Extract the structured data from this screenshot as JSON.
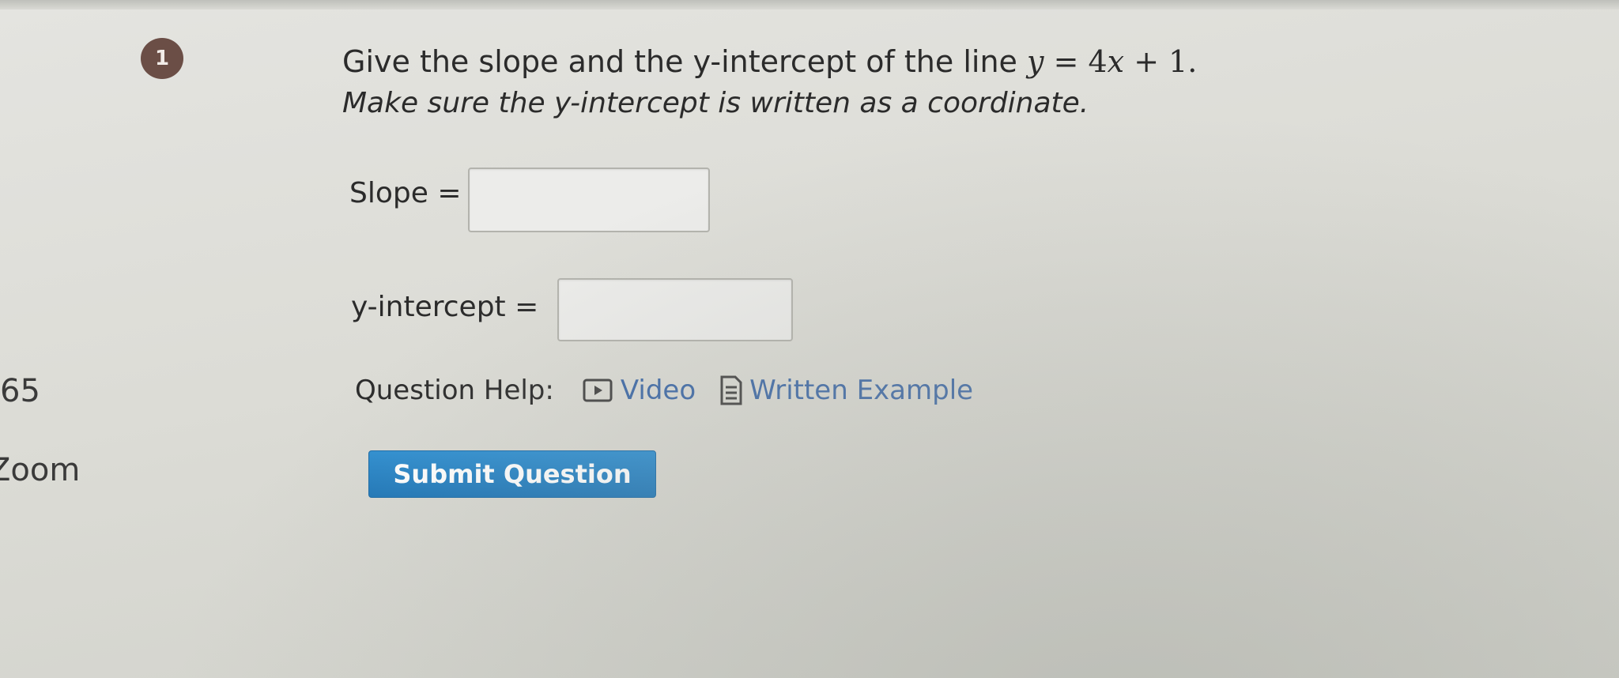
{
  "question": {
    "number": "1",
    "prompt_text": "Give the slope and the y-intercept of the line ",
    "equation": {
      "lhs": "y",
      "eq": " = ",
      "coef": "4",
      "var": "x",
      "plus": " + ",
      "const": "1",
      "end": "."
    },
    "instruction": "Make sure the y-intercept is written as a coordinate."
  },
  "fields": {
    "slope": {
      "label": "Slope =",
      "value": "",
      "placeholder": ""
    },
    "y_intercept": {
      "label": "y-intercept =",
      "value": "",
      "placeholder": ""
    }
  },
  "help": {
    "label": "Question Help:",
    "links": [
      {
        "label": "Video",
        "icon": "video-play-icon"
      },
      {
        "label": "Written Example",
        "icon": "document-icon"
      }
    ]
  },
  "submit": {
    "label": "Submit Question",
    "color": "#2a86c9"
  },
  "side": {
    "number": "65",
    "zoom_text": "Zoom"
  },
  "colors": {
    "badge": "#6b4e46",
    "link": "#3f6aa7"
  }
}
